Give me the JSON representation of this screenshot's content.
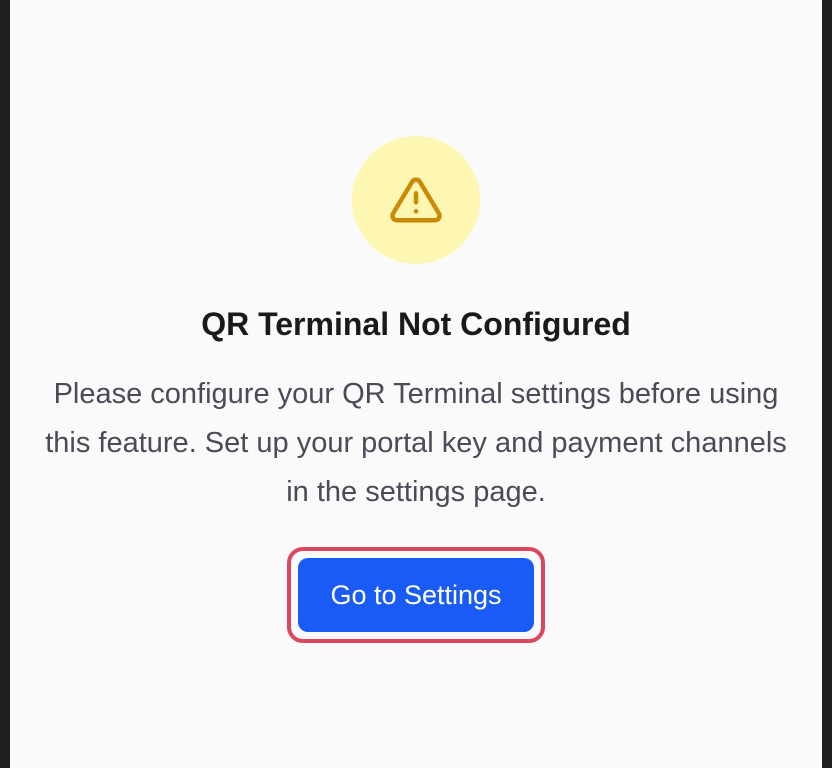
{
  "notice": {
    "icon": "alert-triangle-icon",
    "title": "QR Terminal Not Configured",
    "message": "Please configure your QR Terminal settings before using this feature. Set up your portal key and payment channels in the settings page.",
    "action_label": "Go to Settings"
  },
  "colors": {
    "icon_bg": "#fef7b4",
    "icon_stroke": "#c98a06",
    "button_bg": "#1a5af5",
    "button_text": "#ffffff",
    "focus_ring": "#d9485c",
    "title_text": "#1a1a1a",
    "message_text": "#4b4b57"
  }
}
